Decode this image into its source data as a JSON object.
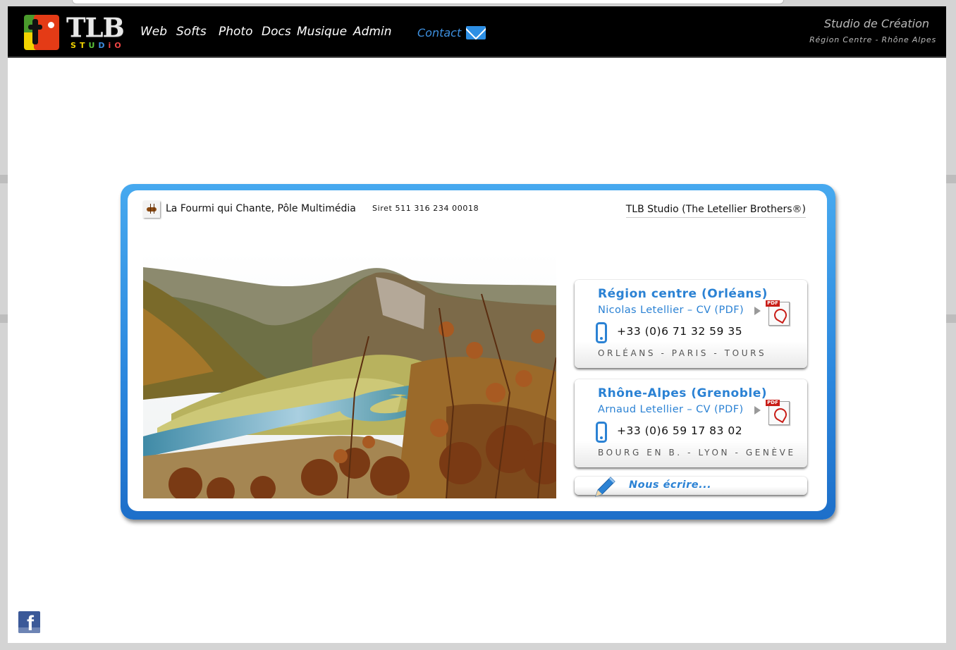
{
  "logo": {
    "title": "TLB",
    "subtitle_letters": [
      "S",
      "T",
      "U",
      "D",
      "i",
      "O"
    ]
  },
  "nav": {
    "items": [
      "Web",
      "Softs",
      "Photo",
      "Docs",
      "Musique",
      "Admin"
    ],
    "contact": "Contact"
  },
  "tagline": {
    "line1": "Studio de Création",
    "line2": "Région Centre - Rhône Alpes"
  },
  "card": {
    "organization": "La Fourmi qui Chante, Pôle Multimédia",
    "siret": "Siret 511 316 234 00018",
    "brand": "TLB Studio (The Letellier Brothers®)"
  },
  "panels": [
    {
      "title": "Région centre (Orléans)",
      "cv": "Nicolas Letellier – CV (PDF)",
      "phone": "+33 (0)6 71 32 59 35",
      "cities": "ORLÉANS - PARIS - TOURS"
    },
    {
      "title": "Rhône-Alpes (Grenoble)",
      "cv": "Arnaud Letellier – CV (PDF)",
      "phone": "+33 (0)6 59 17 83 02",
      "cities": "BOURG EN B. - LYON - GENÈVE"
    }
  ],
  "write": {
    "label": "Nous écrire..."
  },
  "icons": {
    "pdf": "pdf-icon",
    "phone": "phone-icon",
    "mail": "mail-icon",
    "pencil": "pencil-icon",
    "facebook": "facebook-icon",
    "ant": "ant-icon",
    "pdf_label": "PDF",
    "facebook_glyph": "f"
  },
  "colors": {
    "accent": "#2b82d4",
    "frame": "#2a86dd",
    "topbar": "#000000",
    "facebook": "#3b5998"
  }
}
